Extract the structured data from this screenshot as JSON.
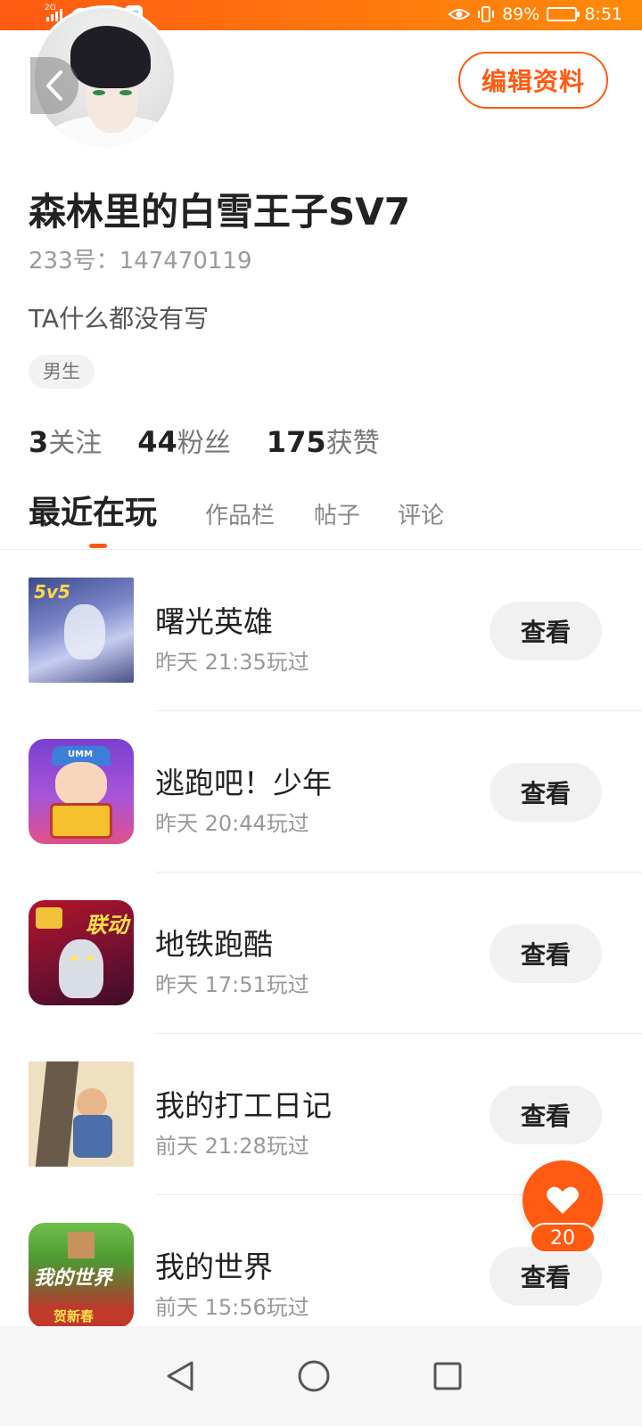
{
  "status_bar": {
    "network": "2G",
    "battery_level": 0.89,
    "battery_text": "89%",
    "time": "8:51",
    "icons": [
      "signal-icon",
      "wifi-icon",
      "app-notification-icon",
      "message-notification-icon",
      "eye-icon",
      "vibrate-icon",
      "battery-icon"
    ]
  },
  "header": {
    "back_icon": "back-arrow-icon",
    "edit_label": "编辑资料"
  },
  "profile": {
    "username": "森林里的白雪王子SV7",
    "user_id": "233号：147470119",
    "bio": "TA什么都没有写",
    "gender": "男生",
    "stats": [
      {
        "value": "3",
        "label": "关注"
      },
      {
        "value": "44",
        "label": "粉丝"
      },
      {
        "value": "175",
        "label": "获赞"
      }
    ]
  },
  "tabs": [
    {
      "label": "最近在玩",
      "active": true
    },
    {
      "label": "作品栏",
      "active": false
    },
    {
      "label": "帖子",
      "active": false
    },
    {
      "label": "评论",
      "active": false
    }
  ],
  "games": [
    {
      "name": "曙光英雄",
      "time": "昨天 21:35玩过",
      "action": "查看",
      "icon_text": "5v5"
    },
    {
      "name": "逃跑吧！少年",
      "time": "昨天 20:44玩过",
      "action": "查看",
      "icon_text": "UMM"
    },
    {
      "name": "地铁跑酷",
      "time": "昨天 17:51玩过",
      "action": "查看",
      "icon_text": "联动"
    },
    {
      "name": "我的打工日记",
      "time": "前天 21:28玩过",
      "action": "查看",
      "icon_text": ""
    },
    {
      "name": "我的世界",
      "time": "前天 15:56玩过",
      "action": "查看",
      "icon_text": "我的世界",
      "icon_subtext": "贺新春"
    }
  ],
  "like_fab": {
    "icon": "heart-icon",
    "count": "20"
  },
  "nav_bar": {
    "icons": [
      "nav-back-icon",
      "nav-home-icon",
      "nav-recents-icon"
    ]
  },
  "colors": {
    "accent": "#ff5a12",
    "text_primary": "#222222",
    "text_secondary": "#999999",
    "button_bg": "#f1f1f1"
  }
}
